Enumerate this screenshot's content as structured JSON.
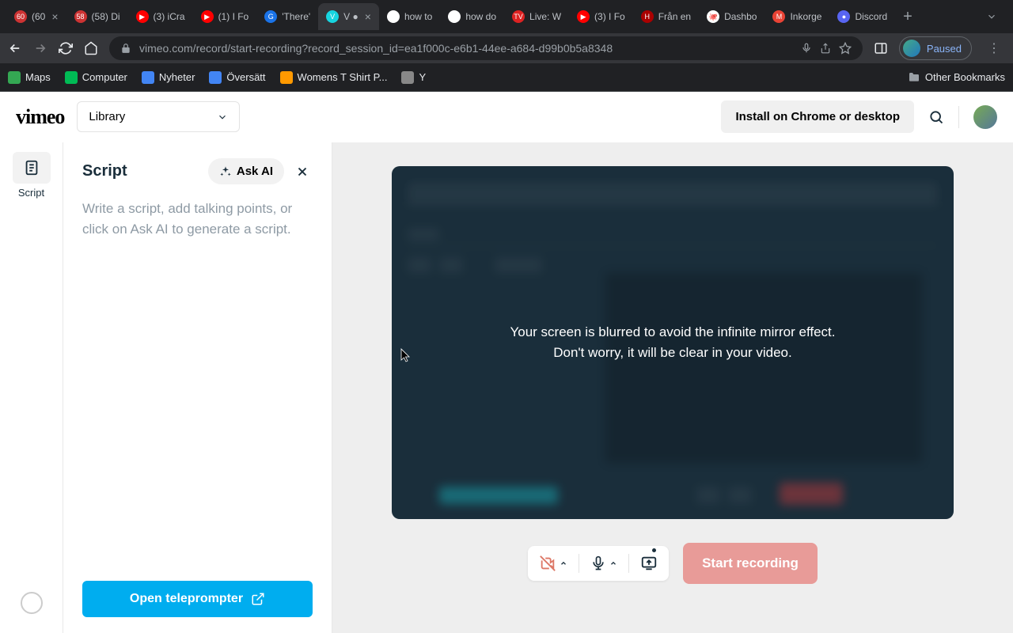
{
  "browser": {
    "tabs": [
      {
        "title": "(60",
        "favicon_bg": "#c33",
        "favicon_text": "60",
        "active": false,
        "close": true
      },
      {
        "title": "(58) Di",
        "favicon_bg": "#c33",
        "favicon_text": "58",
        "active": false
      },
      {
        "title": "(3) iCra",
        "favicon_bg": "#f00",
        "favicon_text": "▶",
        "active": false
      },
      {
        "title": "(1) I Fo",
        "favicon_bg": "#f00",
        "favicon_text": "▶",
        "active": false
      },
      {
        "title": "'There'",
        "favicon_bg": "#1a73e8",
        "favicon_text": "G",
        "active": false
      },
      {
        "title": "V ● ",
        "favicon_bg": "#17d5e0",
        "favicon_text": "V",
        "active": true,
        "close": true
      },
      {
        "title": "how to",
        "favicon_bg": "#fff",
        "favicon_text": "G",
        "active": false
      },
      {
        "title": "how do",
        "favicon_bg": "#fff",
        "favicon_text": "G",
        "active": false
      },
      {
        "title": "Live: W",
        "favicon_bg": "#d22",
        "favicon_text": "TV",
        "active": false
      },
      {
        "title": "(3) I Fo",
        "favicon_bg": "#f00",
        "favicon_text": "▶",
        "active": false
      },
      {
        "title": "Från en",
        "favicon_bg": "#a00",
        "favicon_text": "H",
        "active": false
      },
      {
        "title": "Dashbo",
        "favicon_bg": "#fff",
        "favicon_text": "🐙",
        "active": false
      },
      {
        "title": "Inkorge",
        "favicon_bg": "#ea4335",
        "favicon_text": "M",
        "active": false
      },
      {
        "title": "Discord",
        "favicon_bg": "#5865f2",
        "favicon_text": "●",
        "active": false
      }
    ],
    "url": "vimeo.com/record/start-recording?record_session_id=ea1f000c-e6b1-44ee-a684-d99b0b5a8348",
    "profile_label": "Paused",
    "bookmarks": [
      {
        "label": "Maps",
        "icon_bg": "#34a853"
      },
      {
        "label": "Computer",
        "icon_bg": "#0b5"
      },
      {
        "label": "Nyheter",
        "icon_bg": "#4285f4"
      },
      {
        "label": "Översätt",
        "icon_bg": "#4285f4"
      },
      {
        "label": "Womens T Shirt P...",
        "icon_bg": "#f90"
      },
      {
        "label": "Y",
        "icon_bg": "#888"
      }
    ],
    "other_bookmarks": "Other Bookmarks"
  },
  "app": {
    "logo": "vimeo",
    "library_dd": "Library",
    "install_btn": "Install on Chrome or desktop",
    "rail": {
      "script_label": "Script"
    },
    "script": {
      "title": "Script",
      "ask_ai": "Ask AI",
      "placeholder": "Write a script, add talking points, or click on Ask AI to generate a script.",
      "teleprompter": "Open teleprompter"
    },
    "preview": {
      "line1": "Your screen is blurred to avoid the infinite mirror effect.",
      "line2": "Don't worry, it will be clear in your video."
    },
    "controls": {
      "start": "Start recording"
    }
  }
}
